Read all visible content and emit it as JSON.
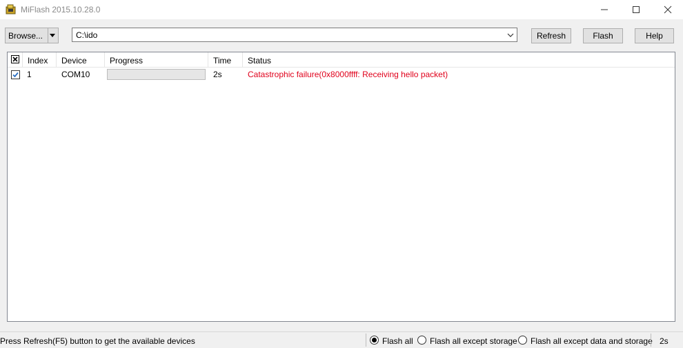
{
  "window": {
    "title": "MiFlash 2015.10.28.0",
    "icon": "miflash-app-icon"
  },
  "toolbar": {
    "browse_label": "Browse...",
    "path_value": "C:\\ido",
    "refresh_label": "Refresh",
    "flash_label": "Flash",
    "help_label": "Help"
  },
  "table": {
    "columns": [
      "Index",
      "Device",
      "Progress",
      "Time",
      "Status"
    ],
    "rows": [
      {
        "checked": true,
        "index": "1",
        "device": "COM10",
        "progress": 0,
        "time": "2s",
        "status": "Catastrophic failure(0x8000ffff: Receiving hello packet)"
      }
    ]
  },
  "statusbar": {
    "message": "Press Refresh(F5) button to get the available devices",
    "options": [
      {
        "label": "Flash all",
        "selected": true
      },
      {
        "label": "Flash all except storage",
        "selected": false
      },
      {
        "label": "Flash all except data and storage",
        "selected": false
      }
    ],
    "elapsed": "2s"
  },
  "colors": {
    "status_error": "#e0001b",
    "check_accent": "#2b6fc2"
  }
}
